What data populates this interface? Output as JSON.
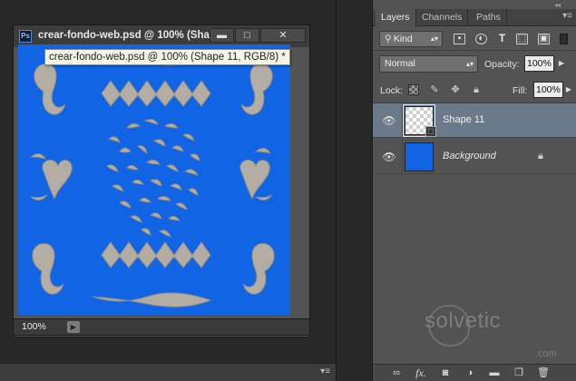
{
  "document": {
    "title": "crear-fondo-web.psd @ 100% (Sha…",
    "tooltip": "crear-fondo-web.psd @ 100% (Shape 11, RGB/8) *",
    "app_icon": "Ps",
    "zoom": "100%",
    "canvas_color": "#1164e4",
    "window_buttons": {
      "minimize": "▬",
      "maximize": "□",
      "close": "✕"
    }
  },
  "panel": {
    "tabs": [
      "Layers",
      "Channels",
      "Paths"
    ],
    "active_tab": "Layers",
    "kind_filter": "Kind",
    "blend_mode": "Normal",
    "opacity_label": "Opacity:",
    "opacity_value": "100%",
    "lock_label": "Lock:",
    "fill_label": "Fill:",
    "fill_value": "100%",
    "layers": [
      {
        "name": "Shape 11",
        "selected": true,
        "visible": true
      },
      {
        "name": "Background",
        "selected": false,
        "visible": true,
        "locked": true
      }
    ]
  },
  "watermark": {
    "text": "solvetic",
    "suffix": ".com"
  },
  "colors": {
    "selection": "#6b7a8a",
    "canvas_blue": "#1164e4",
    "panel_bg": "#535353",
    "workspace_bg": "#282828"
  },
  "icons": {
    "filter": [
      "image-filter-icon",
      "adjustment-filter-icon",
      "type-filter-icon",
      "shape-filter-icon",
      "smart-object-filter-icon"
    ],
    "footer": [
      "link-layers-icon",
      "fx-icon",
      "add-mask-icon",
      "adjustment-layer-icon",
      "new-group-icon",
      "new-layer-icon",
      "trash-icon"
    ]
  }
}
